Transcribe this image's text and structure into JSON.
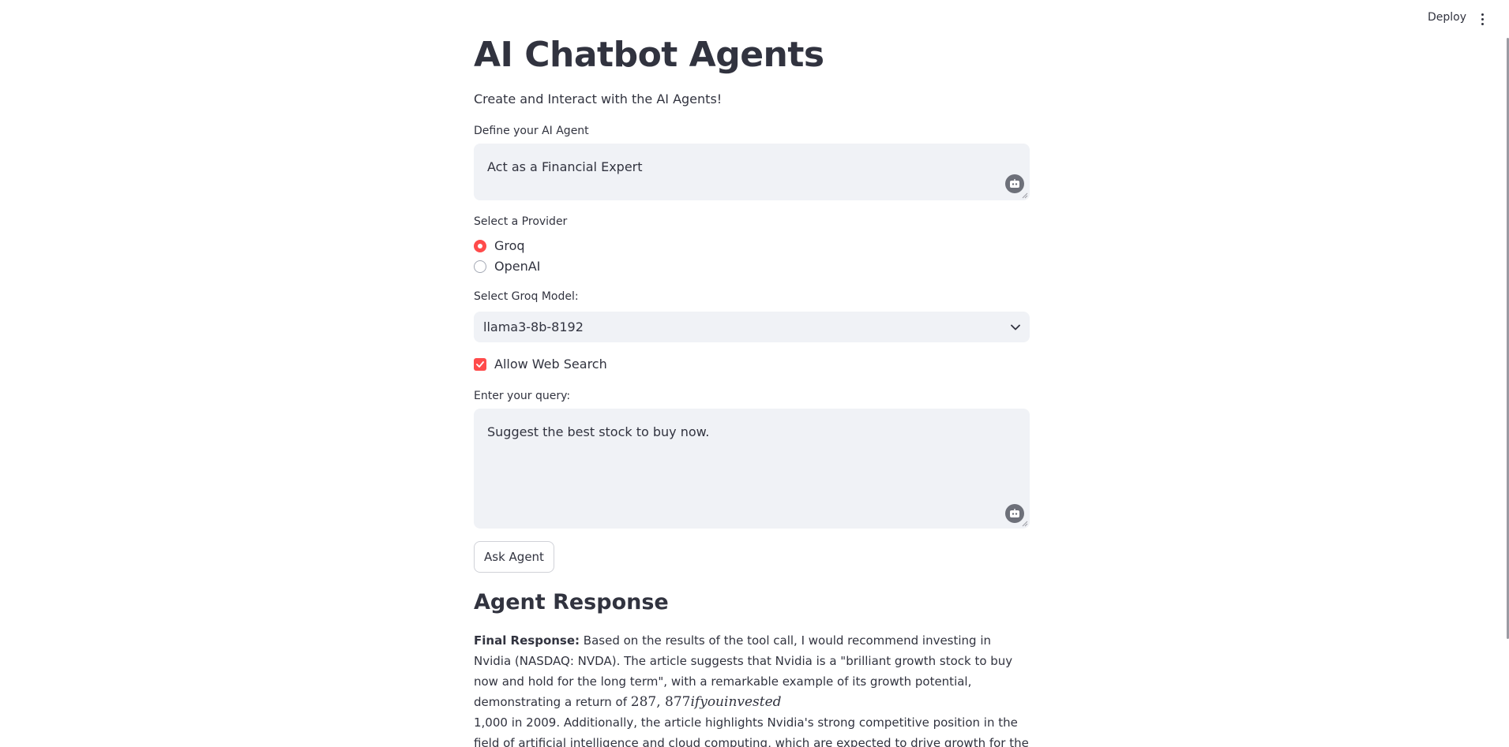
{
  "header": {
    "deploy_label": "Deploy",
    "menu_icon": "more-vertical-icon"
  },
  "page": {
    "title": "AI Chatbot Agents",
    "subtitle": "Create and Interact with the AI Agents!"
  },
  "agent_definition": {
    "label": "Define your AI Agent",
    "value": "Act as a Financial Expert",
    "icon": "bot-icon"
  },
  "provider": {
    "label": "Select a Provider",
    "options": [
      "Groq",
      "OpenAI"
    ],
    "selected": "Groq",
    "accent": "#ff4b4b"
  },
  "model": {
    "label": "Select Groq Model:",
    "selected": "llama3-8b-8192"
  },
  "web_search": {
    "label": "Allow Web Search",
    "checked": true
  },
  "query": {
    "label": "Enter your query:",
    "value": "Suggest the best stock to buy now.",
    "icon": "bot-icon"
  },
  "ask_button": {
    "label": "Ask Agent"
  },
  "response": {
    "heading": "Agent Response",
    "prefix": "Final Response:",
    "text_part1": " Based on the results of the tool call, I would recommend investing in Nvidia (NASDAQ: NVDA). The article suggests that Nvidia is a \"brilliant growth stock to buy now and hold for the long term\", with a remarkable example of its growth potential, demonstrating a return of ",
    "math_inline": "287,877ifyouinvested",
    "text_part2": "1,000 in 2009. Additionally, the article highlights Nvidia's strong competitive position in the field of artificial intelligence and cloud computing, which are expected to drive growth for the company in the long run."
  }
}
